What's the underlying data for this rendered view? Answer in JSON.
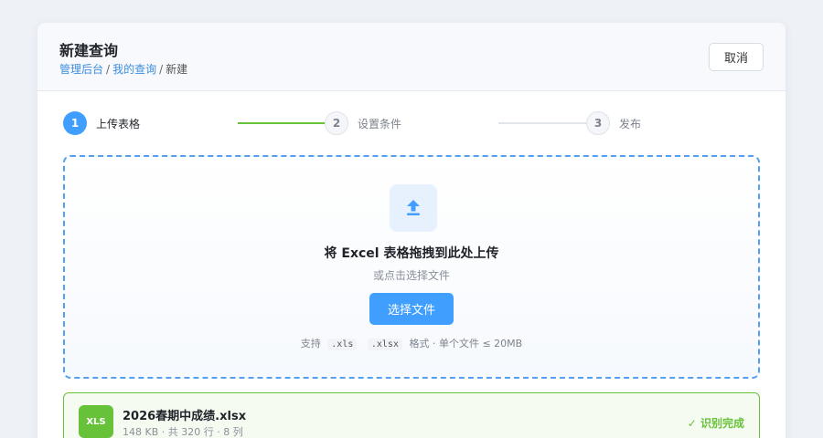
{
  "header": {
    "title": "新建查询",
    "breadcrumb": [
      "管理后台",
      "我的查询",
      "新建"
    ],
    "breadcrumb_sep": "/",
    "cancel_label": "取消"
  },
  "steps": [
    {
      "number": "1",
      "label": "上传表格",
      "state": "active"
    },
    {
      "number": "2",
      "label": "设置条件",
      "state": "pending"
    },
    {
      "number": "3",
      "label": "发布",
      "state": "pending"
    }
  ],
  "dropzone": {
    "icon": "upload-arrow-icon",
    "title": "将 Excel 表格拖拽到此处上传",
    "subtitle": "或点击选择文件",
    "button_label": "选择文件",
    "hint_prefix": "支持",
    "formats": [
      ".xls",
      ".xlsx"
    ],
    "hint_suffix": "格式 · 单个文件 ≤ 20MB"
  },
  "file": {
    "badge": "XLS",
    "name": "2026春期中成绩.xlsx",
    "meta": "148 KB · 共 320 行 · 8 列",
    "status": "✓ 识别完成"
  },
  "colors": {
    "primary": "#409eff",
    "success": "#67c23a",
    "link": "#3c8de0"
  }
}
